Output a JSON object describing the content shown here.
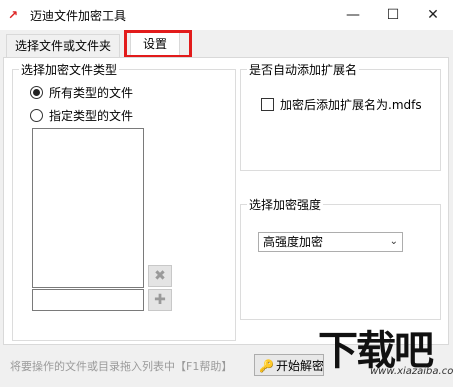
{
  "window": {
    "title": "迈迪文件加密工具",
    "minimize": "—",
    "maximize": "☐",
    "close": "✕"
  },
  "tabs": [
    {
      "label": "选择文件或文件夹"
    },
    {
      "label": "设置"
    }
  ],
  "left_group": {
    "title": "选择加密文件类型",
    "radios": [
      {
        "label": "所有类型的文件",
        "checked": true
      },
      {
        "label": "指定类型的文件",
        "checked": false
      }
    ],
    "delete_icon": "✖",
    "add_icon": "✚"
  },
  "ext_group": {
    "title": "是否自动添加扩展名",
    "checkbox_label": "加密后添加扩展名为.mdfs",
    "checked": false
  },
  "strength_group": {
    "title": "选择加密强度",
    "selected": "高强度加密",
    "arrow": "⌄"
  },
  "status": {
    "text": "将要操作的文件或目录拖入列表中【F1帮助】",
    "start_label": "开始解密",
    "start_icon": "🔑"
  },
  "watermark": {
    "text": "下载吧",
    "url": "www.xiazaiba.com"
  },
  "annotation": {
    "color": "#e21b1b"
  }
}
